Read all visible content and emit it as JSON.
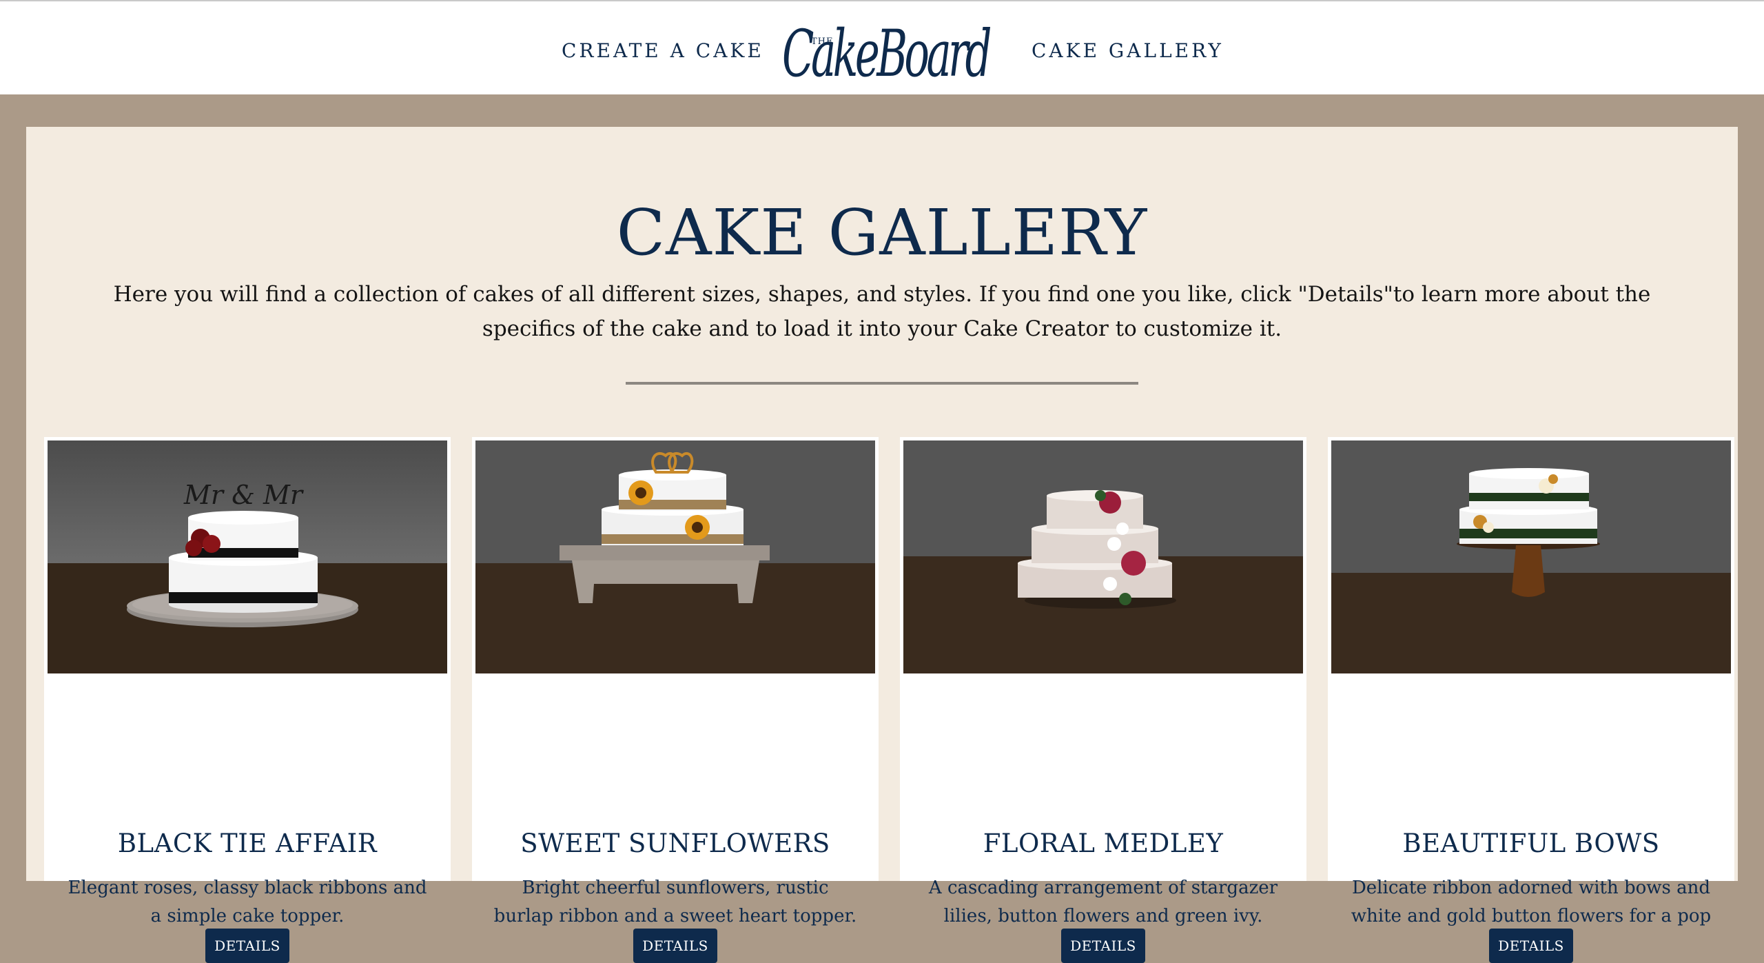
{
  "nav": {
    "create_label": "CREATE A CAKE",
    "gallery_label": "CAKE GALLERY",
    "logo_the": "THE",
    "logo_text": "CakeBoard"
  },
  "main": {
    "title": "CAKE GALLERY",
    "intro": "Here you will find a collection of cakes of all different sizes, shapes, and styles. If you find one you like, click \"Details\"to learn more about the specifics of the cake and to load it into your Cake Creator to customize it."
  },
  "cards": [
    {
      "title": "BLACK TIE AFFAIR",
      "description": "Elegant roses, classy black ribbons and a simple cake topper.",
      "button": "DETAILS",
      "topper_text": "Mr & Mr"
    },
    {
      "title": "SWEET SUNFLOWERS",
      "description": "Bright cheerful sunflowers, rustic burlap ribbon and a sweet heart topper.",
      "button": "DETAILS"
    },
    {
      "title": "FLORAL MEDLEY",
      "description": "A cascading arrangement of stargazer lilies, button flowers and green ivy.",
      "button": "DETAILS"
    },
    {
      "title": "BEAUTIFUL BOWS",
      "description": "Delicate ribbon adorned with bows and white and gold button flowers for a pop of color.",
      "button": "DETAILS"
    }
  ],
  "colors": {
    "navy": "#0e2a4c",
    "panel": "#f3ebe0",
    "frame": "#ab9a88"
  }
}
